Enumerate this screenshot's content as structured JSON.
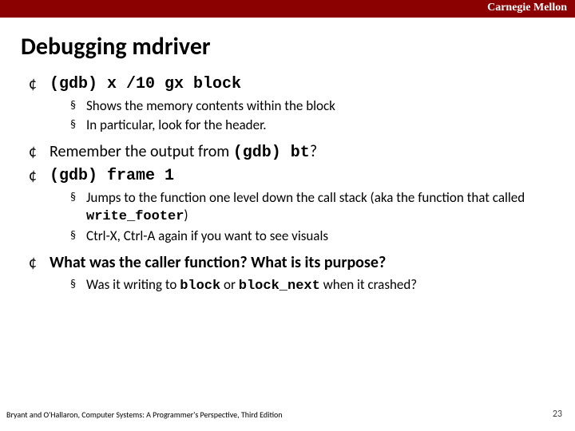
{
  "header": {
    "brand": "Carnegie Mellon"
  },
  "title": "Debugging mdriver",
  "items": [
    {
      "pre1": "(gdb) x /10 gx block",
      "sub": [
        {
          "text": "Shows the memory contents within the block"
        },
        {
          "text": "In particular, look for the header."
        }
      ]
    },
    {
      "pre_before": "Remember the output from ",
      "pre_code": "(gdb) bt",
      "pre_after": "?"
    },
    {
      "pre1": "(gdb) frame 1",
      "sub": [
        {
          "text_before": "Jumps to the function one level down the call stack (aka the function that called ",
          "code": "write_footer",
          "text_after": ")"
        },
        {
          "text": "Ctrl-X, Ctrl-A again if you want to see visuals"
        }
      ]
    },
    {
      "bold_text": "What was the caller function? What is its purpose?",
      "sub": [
        {
          "text_before": "Was it writing to ",
          "code": "block",
          "mid": " or ",
          "code2": "block_next",
          "text_after": " when it crashed?"
        }
      ]
    }
  ],
  "footer": "Bryant and O'Hallaron, Computer Systems: A Programmer's Perspective, Third Edition",
  "page": "23"
}
